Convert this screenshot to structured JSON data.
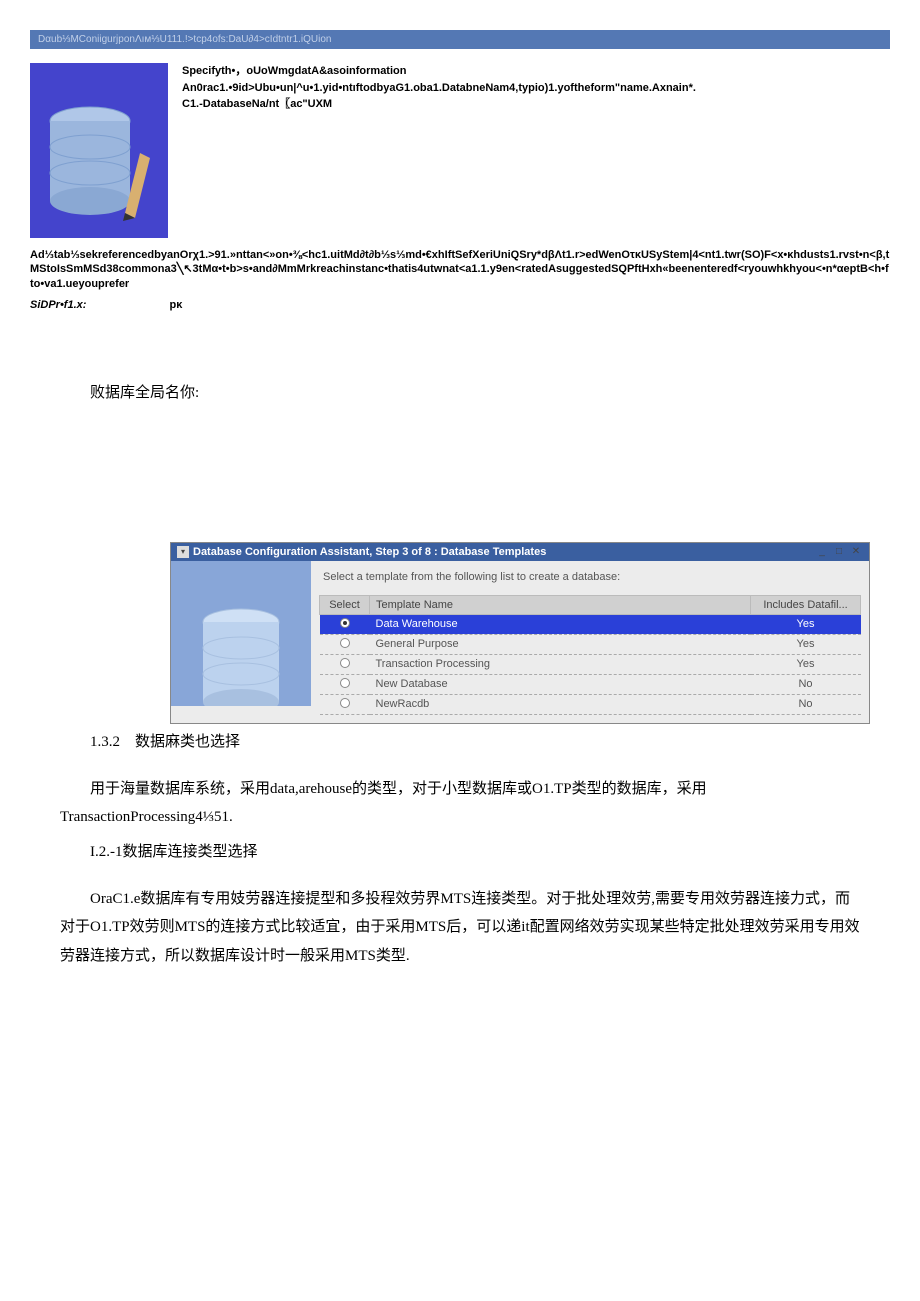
{
  "dialog1": {
    "titlebar": "Dαub⅓MConiigurjponΛıм⅓U111.!>tcp4ofs:DaU∂4>cIdtntr1.iQUion",
    "line1": "Specifyth•，oUoWmgdatA&asoinformation",
    "line2": "An0rac1.•9id>Ubu•un|^u•1.yid•ntıftodbyaG1.oba1.DatabneNam4,typio)1.yoftheform\"name.Axnain*.",
    "line3": "C1.-DatabaseNa/nt〖ac\"UXM"
  },
  "garbled": "Ad⅓tab⅓sekreferencedbyanOrχ1.>91.»nttan<»on•⅜<hc1.uitMd∂t∂b⅓s⅓md•€xhIftSefXeriUniQSry*dβΛt1.r>edWenOτκUSyStem|4<nt1.twr(SO)F<x•κhdusts1.rvst•n<β,tMStoIsSmMSd38commona3╲↖3tMα•t•b>s•and∂MmMrkreachinstanс•thatis4utwnat<a1.1.y9en<ratedAsuggestedSQPftHxh«beenenteredf<ryouwhkhyou<•n*αeptB<h•fto•va1.ueyouprefer",
  "sid": {
    "label": "SiDPr•f1.x:",
    "value": "pκ"
  },
  "chinese_heading_1": "败据库全局名你:",
  "dialog2": {
    "titlebar": "Database Configuration Assistant, Step 3 of 8 : Database Templates",
    "instruction": "Select a template from the following list to create a database:",
    "columns": {
      "select": "Select",
      "name": "Template Name",
      "includes": "Includes Datafil..."
    },
    "rows": [
      {
        "selected": true,
        "name": "Data Warehouse",
        "includes": "Yes"
      },
      {
        "selected": false,
        "name": "General Purpose",
        "includes": "Yes"
      },
      {
        "selected": false,
        "name": "Transaction Processing",
        "includes": "Yes"
      },
      {
        "selected": false,
        "name": "New Database",
        "includes": "No"
      },
      {
        "selected": false,
        "name": "NewRacdb",
        "includes": "No"
      }
    ]
  },
  "section_1_3_2": "1.3.2　数据麻类也选择",
  "para1": "用于海量数据库系统，采用data,arehouse的类型，对于小型数据库或O1.TP类型的数据库，采用TransactionProcessing4⅓51.",
  "sub_heading": "I.2.-1数据库连接类型选择",
  "para2": "OraC1.e数据库有专用妓劳器连接提型和多投程效劳界MTS连接类型。对于批处理效劳,需要专用效劳器连接力式，而对于O1.TP效劳则MTS的连接方式比较适宜，由于采用MTS后，可以递it配置网络效劳实现某些特定批处理效劳采用专用效劳器连接方式，所以数据库设计时一般采用MTS类型."
}
